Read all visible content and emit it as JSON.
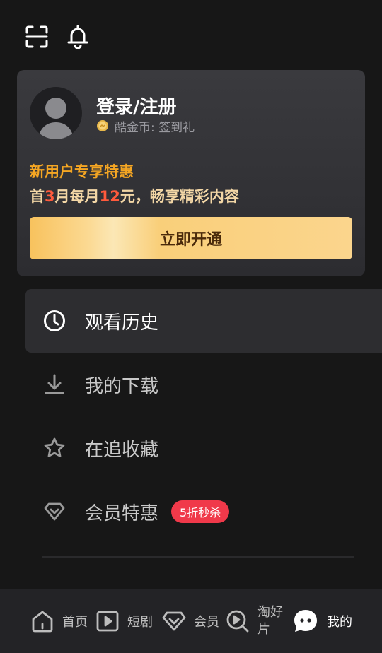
{
  "topbar": {
    "icons": [
      "scan-icon",
      "bell-icon"
    ]
  },
  "member_card": {
    "login_title": "登录/注册",
    "coin_text": "酷金币: 签到礼",
    "promo_title": "新用户专享特惠",
    "promo_sub": {
      "part1": "首",
      "num1": "3",
      "part2": "月每月",
      "num2": "12",
      "part3": "元，畅享精彩内容"
    },
    "open_button": "立即开通",
    "colors": {
      "promo_title": "#f5a623",
      "highlight": "#ff5a3c",
      "button": "#fbd58d"
    }
  },
  "menu": {
    "items": [
      {
        "label": "观看历史",
        "icon": "clock-icon",
        "active": true
      },
      {
        "label": "我的下载",
        "icon": "download-icon"
      },
      {
        "label": "在追收藏",
        "icon": "star-icon"
      },
      {
        "label": "会员特惠",
        "icon": "diamond-icon",
        "badge": "5折秒杀"
      }
    ]
  },
  "bottom_nav": {
    "items": [
      {
        "label": "首页",
        "icon": "home-icon"
      },
      {
        "label": "短剧",
        "icon": "play-icon"
      },
      {
        "label": "会员",
        "icon": "vip-diamond-icon"
      },
      {
        "label": "淘好片",
        "icon": "search-play-icon"
      },
      {
        "label": "我的",
        "icon": "profile-face-icon",
        "active": true
      }
    ]
  }
}
